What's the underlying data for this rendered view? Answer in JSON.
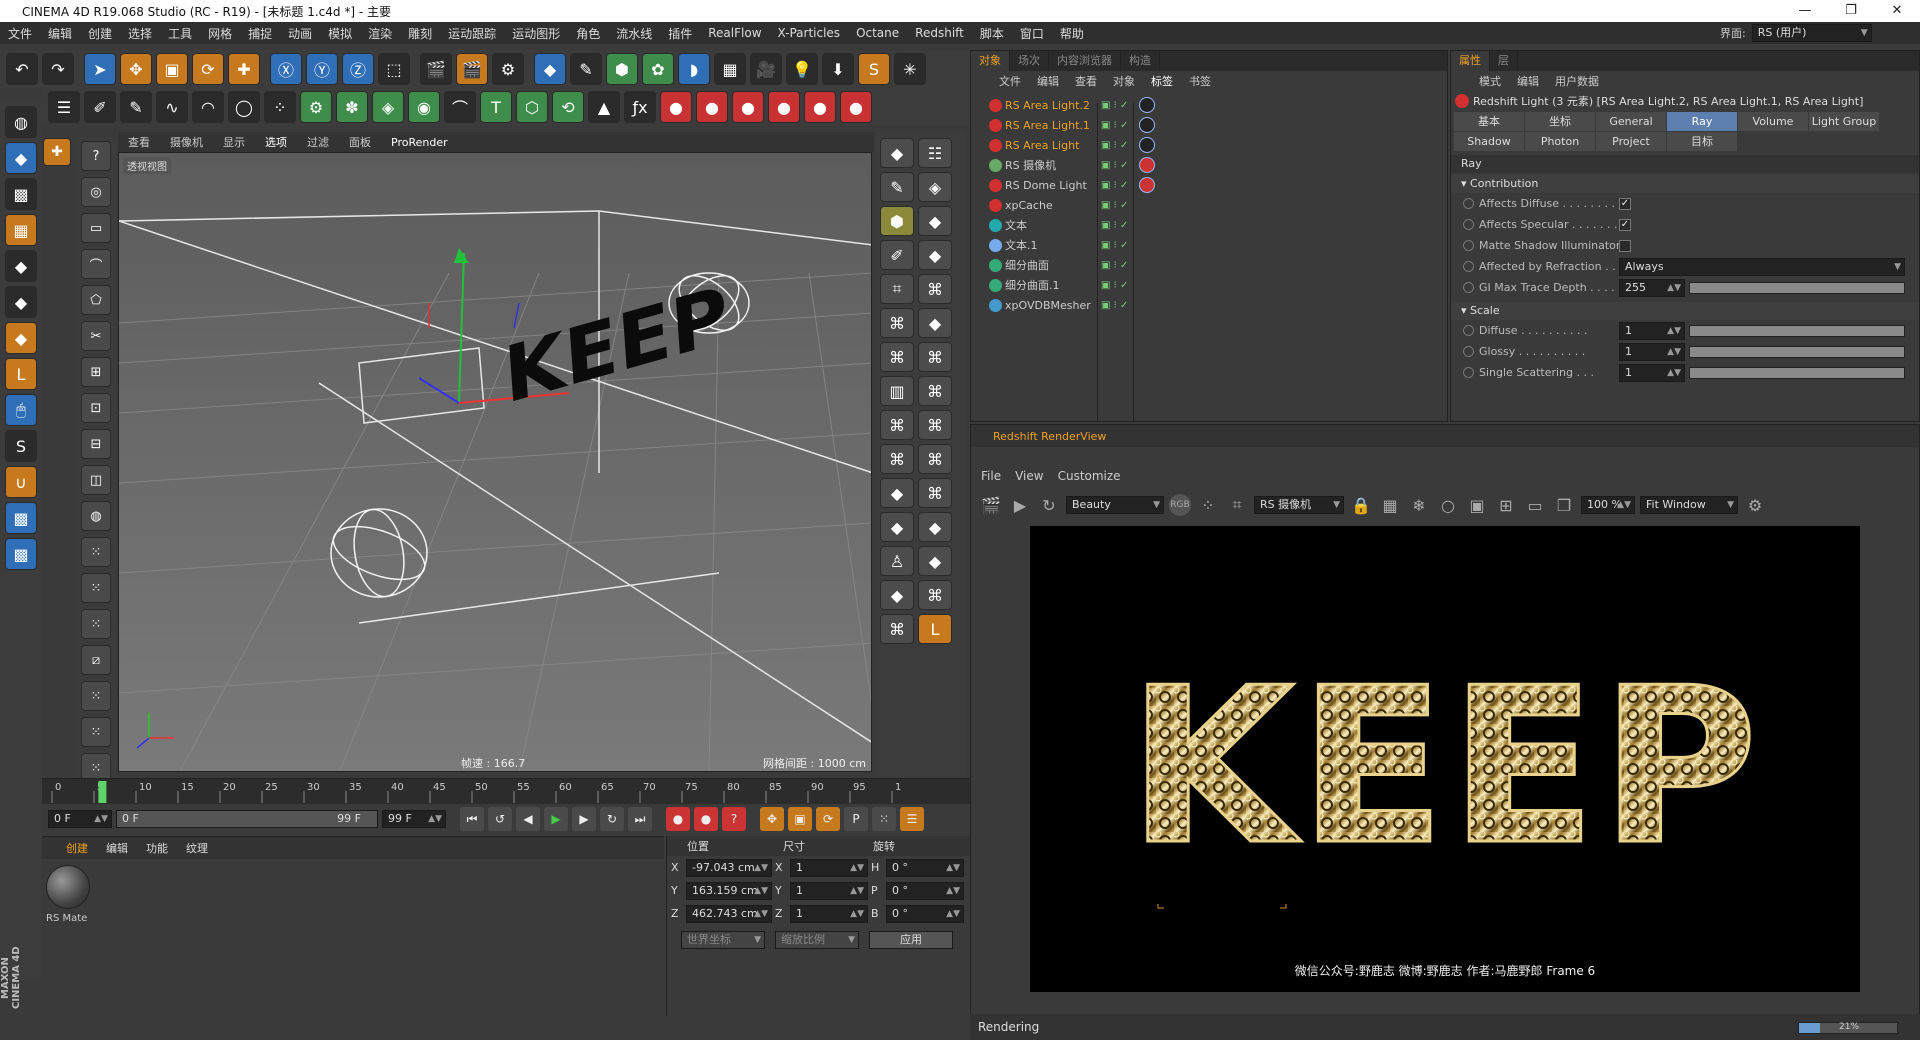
{
  "window": {
    "title": "CINEMA 4D R19.068 Studio (RC - R19) - [未标题 1.c4d *] - 主要",
    "min": "—",
    "max": "❐",
    "close": "✕"
  },
  "menu": [
    "文件",
    "编辑",
    "创建",
    "选择",
    "工具",
    "网格",
    "捕捉",
    "动画",
    "模拟",
    "渲染",
    "雕刻",
    "运动跟踪",
    "运动图形",
    "角色",
    "流水线",
    "插件",
    "RealFlow",
    "X-Particles",
    "Octane",
    "Redshift",
    "脚本",
    "窗口",
    "帮助"
  ],
  "interface": {
    "label": "界面:",
    "value": "RS (用户)"
  },
  "viewport": {
    "menu": [
      "查看",
      "摄像机",
      "显示",
      "选项",
      "过滤",
      "面板",
      "ProRender"
    ],
    "name": "透视视图",
    "fps": "帧速 : 166.7",
    "grid": "网格间距 : 1000 cm",
    "text3d": "KEEP"
  },
  "timeline": {
    "ticks": [
      "0",
      "5",
      "10",
      "15",
      "20",
      "25",
      "30",
      "35",
      "40",
      "45",
      "50",
      "55",
      "60",
      "65",
      "70",
      "75",
      "80",
      "85",
      "90",
      "95",
      "1"
    ],
    "current": "6 F",
    "current_frac": 0.06
  },
  "frames": {
    "start": "0 F",
    "range_start": "0 F",
    "range_end": "99 F",
    "end": "99 F"
  },
  "materials": {
    "menu": [
      "创建",
      "编辑",
      "功能",
      "纹理"
    ],
    "item": "RS Mate"
  },
  "coords": {
    "headers": [
      "位置",
      "尺寸",
      "旋转"
    ],
    "rows": [
      {
        "a": "X",
        "pos": "-97.043 cm",
        "b": "X",
        "size": "1",
        "c": "H",
        "rot": "0 °"
      },
      {
        "a": "Y",
        "pos": "163.159 cm",
        "b": "Y",
        "size": "1",
        "c": "P",
        "rot": "0 °"
      },
      {
        "a": "Z",
        "pos": "462.743 cm",
        "b": "Z",
        "size": "1",
        "c": "B",
        "rot": "0 °"
      }
    ],
    "space": "世界坐标",
    "scale": "缩放比例",
    "apply": "应用"
  },
  "objects": {
    "tabs": [
      "对象",
      "场次",
      "内容浏览器",
      "构造"
    ],
    "menu": [
      "文件",
      "编辑",
      "查看",
      "对象",
      "标签",
      "书签"
    ],
    "items": [
      {
        "name": "RS Area Light.2",
        "sel": true
      },
      {
        "name": "RS Area Light.1",
        "sel": true
      },
      {
        "name": "RS Area Light",
        "sel": true
      },
      {
        "name": "RS 摄像机",
        "sel": false
      },
      {
        "name": "RS Dome Light",
        "sel": false
      },
      {
        "name": "xpCache",
        "sel": false
      },
      {
        "name": "文本",
        "sel": false
      },
      {
        "name": "文本.1",
        "sel": false
      },
      {
        "name": "细分曲面",
        "sel": false
      },
      {
        "name": "细分曲面.1",
        "sel": false
      },
      {
        "name": "xpOVDBMesher",
        "sel": false
      }
    ]
  },
  "attributes": {
    "tabs": [
      "属性",
      "层"
    ],
    "menu": [
      "模式",
      "编辑",
      "用户数据"
    ],
    "title": "Redshift Light (3 元素) [RS Area Light.2, RS Area Light.1, RS Area Light]",
    "buttons1": [
      "基本",
      "坐标",
      "General",
      "Ray",
      "Volume",
      "Light Group"
    ],
    "buttons2": [
      "Shadow",
      "Photon",
      "Project",
      "目标"
    ],
    "section": "Ray",
    "contribution": "Contribution",
    "rows": [
      {
        "label": "Affects Diffuse . . . . . . . . .",
        "check": "✓"
      },
      {
        "label": "Affects Specular . . . . . . . .",
        "check": "✓"
      },
      {
        "label": "Matte Shadow Illuminator",
        "check": ""
      }
    ],
    "refraction": {
      "label": "Affected by Refraction . . .",
      "value": "Always"
    },
    "gi": {
      "label": "GI Max Trace Depth . . . . .",
      "value": "255"
    },
    "scale": "Scale",
    "scale_rows": [
      {
        "label": "Diffuse . . . . . . . . . .",
        "value": "1"
      },
      {
        "label": "Glossy . . . . . . . . . .",
        "value": "1"
      },
      {
        "label": "Single Scattering . . .",
        "value": "1"
      }
    ]
  },
  "renderview": {
    "title": "Redshift RenderView",
    "menu": [
      "File",
      "View",
      "Customize"
    ],
    "aov": "Beauty",
    "rgb": "RGB",
    "camera": "RS 摄像机",
    "zoom": "100 %",
    "fit": "Fit Window",
    "caption": "微信公众号:野鹿志   微博:野鹿志   作者:马鹿野郎  Frame  6",
    "word": "KEEP",
    "status": "Rendering",
    "progress_text": "21%",
    "progress": 0.21
  },
  "brand": "MAXON CINEMA 4D"
}
